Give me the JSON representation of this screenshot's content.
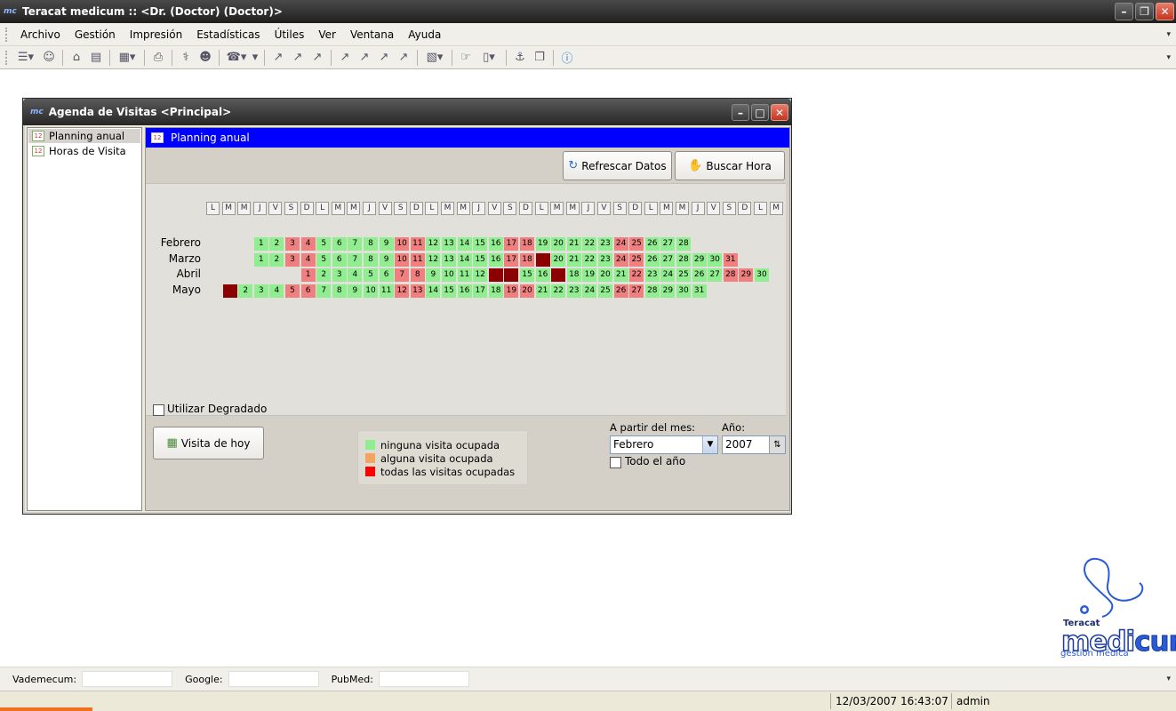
{
  "app": {
    "title": "Teracat medicum :: <Dr. (Doctor) (Doctor)>",
    "icon_text": "mc"
  },
  "menu": [
    "Archivo",
    "Gestión",
    "Impresión",
    "Estadísticas",
    "Útiles",
    "Ver",
    "Ventana",
    "Ayuda"
  ],
  "toolbar_icons": [
    "new-record-icon",
    "user-icon",
    "home-icon",
    "folder-icon",
    "calendar-icon",
    "print-icon",
    "stethoscope-icon",
    "user-edit-icon",
    "phone-icon",
    "chart-icon",
    "chart-2-icon",
    "chart-3-icon",
    "chart-4-icon",
    "chart-5-icon",
    "chart-6-icon",
    "chart-7-icon",
    "report-icon",
    "hand-icon",
    "document-icon",
    "link-icon",
    "copy-icon",
    "help-icon"
  ],
  "child_window": {
    "title": "Agenda de Visitas  <Principal>",
    "tree": [
      {
        "label": "Planning anual",
        "selected": true
      },
      {
        "label": "Horas de Visita",
        "selected": false
      }
    ],
    "panel_title": "Planning anual",
    "refresh_button": "Refrescar Datos",
    "search_button": "Buscar Hora",
    "weekday_header": [
      "L",
      "M",
      "M",
      "J",
      "V",
      "S",
      "D",
      "L",
      "M",
      "M",
      "J",
      "V",
      "S",
      "D",
      "L",
      "M",
      "M",
      "J",
      "V",
      "S",
      "D",
      "L",
      "M",
      "M",
      "J",
      "V",
      "S",
      "D",
      "L",
      "M",
      "M",
      "J",
      "V",
      "S",
      "D",
      "L",
      "M"
    ],
    "months": [
      {
        "name": "Febrero",
        "offset": 3,
        "days": [
          "g",
          "g",
          "p",
          "p",
          "g",
          "g",
          "g",
          "g",
          "g",
          "p",
          "p",
          "g",
          "g",
          "g",
          "g",
          "g",
          "p",
          "p",
          "g",
          "g",
          "g",
          "g",
          "g",
          "p",
          "p",
          "g",
          "g",
          "g"
        ]
      },
      {
        "name": "Marzo",
        "offset": 3,
        "days": [
          "g",
          "g",
          "p",
          "p",
          "g",
          "g",
          "g",
          "g",
          "g",
          "p",
          "p",
          "g",
          "g",
          "g",
          "g",
          "g",
          "p",
          "p",
          "r",
          "g",
          "g",
          "g",
          "g",
          "p",
          "p",
          "g",
          "g",
          "g",
          "g",
          "g",
          "p"
        ]
      },
      {
        "name": "Abril",
        "offset": 6,
        "days": [
          "p",
          "g",
          "g",
          "g",
          "g",
          "g",
          "p",
          "p",
          "g",
          "g",
          "g",
          "g",
          "r",
          "r",
          "g",
          "g",
          "r",
          "g",
          "g",
          "g",
          "g",
          "p",
          "g",
          "g",
          "g",
          "g",
          "g",
          "p",
          "p",
          "g"
        ]
      },
      {
        "name": "Mayo",
        "offset": 1,
        "days": [
          "r",
          "g",
          "g",
          "g",
          "p",
          "p",
          "g",
          "g",
          "g",
          "g",
          "g",
          "p",
          "p",
          "g",
          "g",
          "g",
          "g",
          "g",
          "p",
          "p",
          "g",
          "g",
          "g",
          "g",
          "g",
          "p",
          "p",
          "g",
          "g",
          "g",
          "g"
        ]
      }
    ],
    "gradient_checkbox": {
      "label": "Utilizar Degradado",
      "checked": false
    },
    "today_button": "Visita de hoy",
    "legend": [
      {
        "label": "ninguna visita ocupada",
        "color": "#90ee90"
      },
      {
        "label": "alguna visita ocupada",
        "color": "#f4a460"
      },
      {
        "label": "todas las visitas ocupadas",
        "color": "#ff0000"
      }
    ],
    "from_month": {
      "label": "A partir del mes:",
      "value": "Febrero"
    },
    "year": {
      "label": "Año:",
      "value": "2007"
    },
    "whole_year": {
      "label": "Todo el año",
      "checked": false
    }
  },
  "logo": {
    "small": "Teracat",
    "brand_a": "medi",
    "brand_b": "cum",
    "sub": "gestión médica"
  },
  "search": {
    "vademecum": "Vademecum:",
    "google": "Google:",
    "pubmed": "PubMed:"
  },
  "status": {
    "datetime": "12/03/2007 16:43:07",
    "user": "admin"
  },
  "colors": {
    "green": "#90ee90",
    "pink": "#f08080",
    "dark_red": "#8b0000",
    "panel_header": "#0000ff"
  }
}
